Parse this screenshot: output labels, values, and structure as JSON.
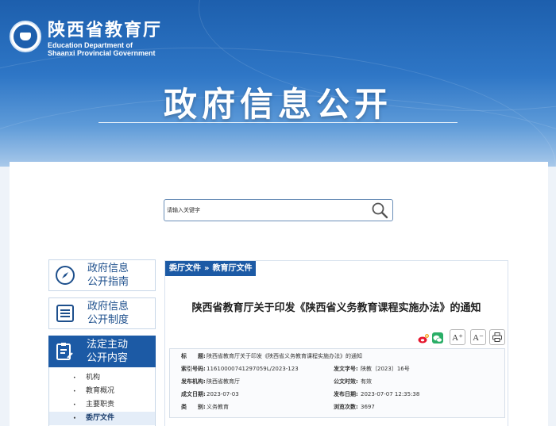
{
  "header": {
    "org_cn": "陕西省教育厅",
    "org_en_line1": "Education Department of",
    "org_en_line2": "Shaanxi Provincial Government",
    "banner_title": "政府信息公开"
  },
  "search": {
    "placeholder": "请输入关键字"
  },
  "nav": {
    "guide_line1": "政府信息",
    "guide_line2": "公开指南",
    "system_line1": "政府信息",
    "system_line2": "公开制度",
    "active_line1": "法定主动",
    "active_line2": "公开内容",
    "sub_items": [
      "机构",
      "教育概况",
      "主要职责",
      "委厅文件"
    ]
  },
  "breadcrumb": {
    "first": "委厅文件",
    "sep": "»",
    "second": "教育厅文件"
  },
  "article": {
    "title": "陕西省教育厅关于印发《陕西省义务教育课程实施办法》的通知"
  },
  "toolbar": {
    "font_up": "A⁺",
    "font_down": "A⁻"
  },
  "meta": {
    "title_label": "标　　题:",
    "title_value": "陕西省教育厅关于印发《陕西省义务教育课程实施办法》的通知",
    "index_label": "索引号码:",
    "index_value": "11610000741297059L/2023-123",
    "docno_label": "发文字号:",
    "docno_value": "陕教〔2023〕16号",
    "issuer_label": "发布机构:",
    "issuer_value": "陕西省教育厅",
    "status_label": "公文时效:",
    "status_value": "有效",
    "created_label": "成文日期:",
    "created_value": "2023-07-03",
    "published_label": "发布日期:",
    "published_value": "2023-07-07 12:35:38",
    "category_label": "类　　别:",
    "category_value": "义务教育",
    "views_label": "浏览次数:",
    "views_value": "3697"
  },
  "colors": {
    "primary": "#1c5aa5",
    "banner_top": "#1d5fad",
    "weibo": "#e6162d",
    "wechat": "#2aae67"
  }
}
